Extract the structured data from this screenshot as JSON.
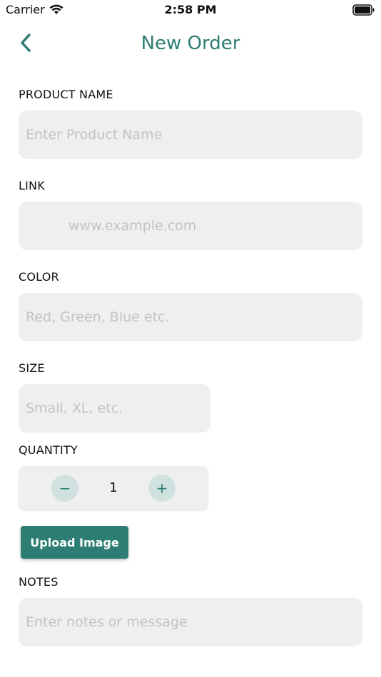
{
  "status_bar": {
    "carrier": "Carrier",
    "time": "2:58 PM"
  },
  "header": {
    "title": "New Order"
  },
  "form": {
    "product_name": {
      "label": "PRODUCT NAME",
      "placeholder": "Enter Product Name",
      "value": ""
    },
    "link": {
      "label": "LINK",
      "placeholder": "www.example.com",
      "value": ""
    },
    "color": {
      "label": "COLOR",
      "placeholder": "Red, Green, Blue etc.",
      "value": ""
    },
    "size": {
      "label": "SIZE",
      "placeholder": "Small, XL, etc.",
      "value": ""
    },
    "quantity": {
      "label": "QUANTITY",
      "value": "1",
      "minus": "−",
      "plus": "+"
    },
    "upload_button": "Upload Image",
    "notes": {
      "label": "NOTES",
      "placeholder": "Enter notes or message",
      "value": ""
    }
  },
  "colors": {
    "accent": "#2e7d74",
    "field_bg": "#efefef",
    "stepper_btn_bg": "#cfe2df"
  }
}
